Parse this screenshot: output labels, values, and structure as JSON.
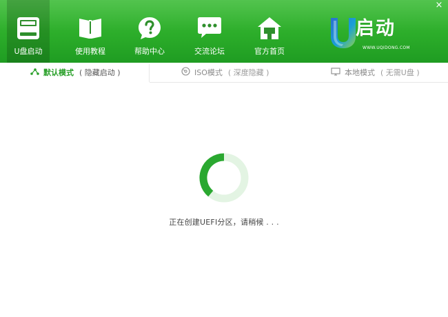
{
  "window": {
    "close_glyph": "×"
  },
  "nav": {
    "items": [
      {
        "label": "U盘启动",
        "icon": "usb-drive-icon",
        "active": true
      },
      {
        "label": "使用教程",
        "icon": "book-icon",
        "active": false
      },
      {
        "label": "帮助中心",
        "icon": "help-icon",
        "active": false
      },
      {
        "label": "交流论坛",
        "icon": "chat-icon",
        "active": false
      },
      {
        "label": "官方首页",
        "icon": "home-icon",
        "active": false
      }
    ]
  },
  "logo": {
    "brand": "启动",
    "url": "WWW.UQIDONG.COM"
  },
  "tabs": [
    {
      "title": "默认模式",
      "sub": "( 隐藏启动 )",
      "icon": "share-icon",
      "active": true
    },
    {
      "title": "ISO模式",
      "sub": "( 深度隐藏 )",
      "icon": "disc-icon",
      "active": false
    },
    {
      "title": "本地模式",
      "sub": "( 无需U盘 )",
      "icon": "monitor-icon",
      "active": false
    }
  ],
  "status": {
    "text": "正在创建UEFI分区，请稍候 . . ."
  },
  "colors": {
    "header_green": "#2cad2a",
    "accent_green": "#2aa02a",
    "spinner_track": "#e3f4e3",
    "spinner_arc": "#2aa830"
  }
}
